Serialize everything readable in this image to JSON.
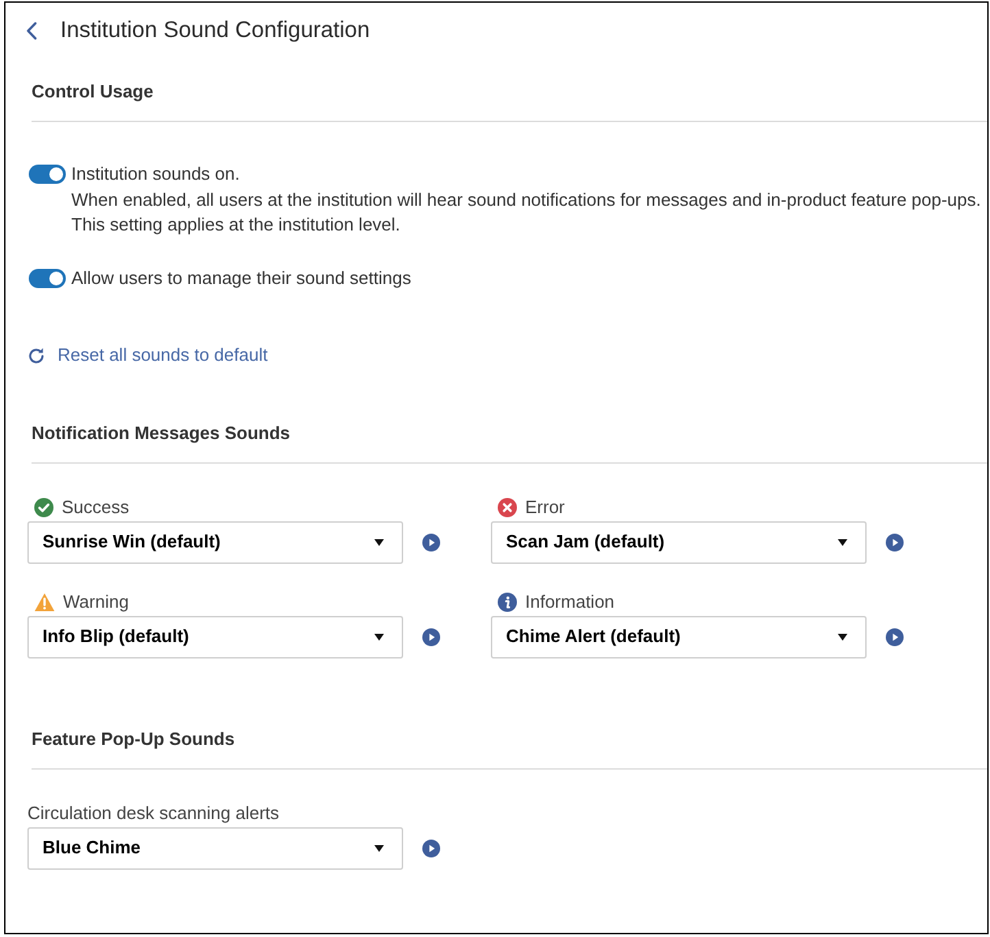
{
  "page": {
    "title": "Institution Sound Configuration"
  },
  "control_usage": {
    "heading": "Control Usage",
    "toggles": [
      {
        "label": "Institution sounds on.",
        "description": [
          "When enabled, all users at the institution will hear sound notifications for messages and in-product feature pop-ups.",
          "This setting applies at the institution level."
        ],
        "on": true
      },
      {
        "label": "Allow users to manage their sound settings",
        "on": true
      }
    ],
    "reset_link": "Reset all sounds to default"
  },
  "notification_sounds": {
    "heading": "Notification Messages Sounds",
    "items": [
      {
        "kind": "success",
        "label": "Success",
        "value": "Sunrise Win (default)"
      },
      {
        "kind": "error",
        "label": "Error",
        "value": "Scan Jam (default)"
      },
      {
        "kind": "warning",
        "label": "Warning",
        "value": "Info Blip (default)"
      },
      {
        "kind": "info",
        "label": "Information",
        "value": "Chime Alert (default)"
      }
    ]
  },
  "feature_sounds": {
    "heading": "Feature Pop-Up Sounds",
    "items": [
      {
        "kind": "plain",
        "label": "Circulation desk scanning alerts",
        "value": "Blue Chime"
      }
    ]
  }
}
